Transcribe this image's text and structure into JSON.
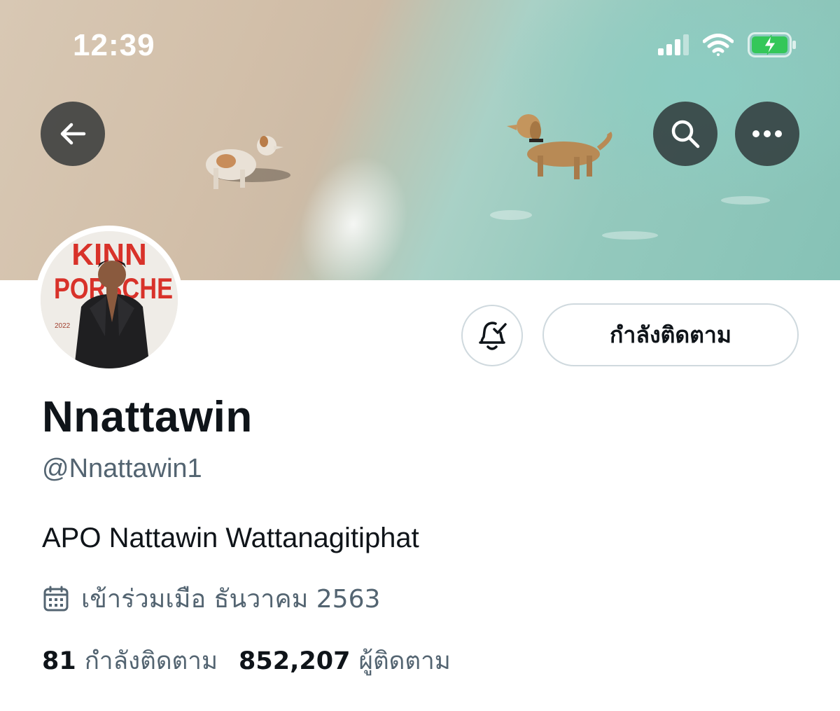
{
  "status_bar": {
    "time": "12:39"
  },
  "header": {
    "back_icon": "arrow-left-icon",
    "search_icon": "search-icon",
    "more_icon": "more-horizontal-icon"
  },
  "avatar": {
    "poster_title_line1": "KINN",
    "poster_title_line2": "PORSCHE",
    "poster_year": "2022"
  },
  "actions": {
    "notify_icon": "bell-check-icon",
    "follow_label": "กำลังติดตาม"
  },
  "profile": {
    "display_name": "Nnattawin",
    "handle": "@Nnattawin1",
    "bio": "APO Nattawin Wattanagitiphat",
    "joined_icon": "calendar-icon",
    "joined": "เข้าร่วมเมือ ธันวาคม 2563"
  },
  "stats": {
    "following_count": "81",
    "following_label": "กำลังติดตาม",
    "followers_count": "852,207",
    "followers_label": "ผู้ติดตาม"
  },
  "colors": {
    "text": "#0f1419",
    "secondary": "#536471",
    "border": "#cfd9de",
    "battery": "#34c759"
  }
}
